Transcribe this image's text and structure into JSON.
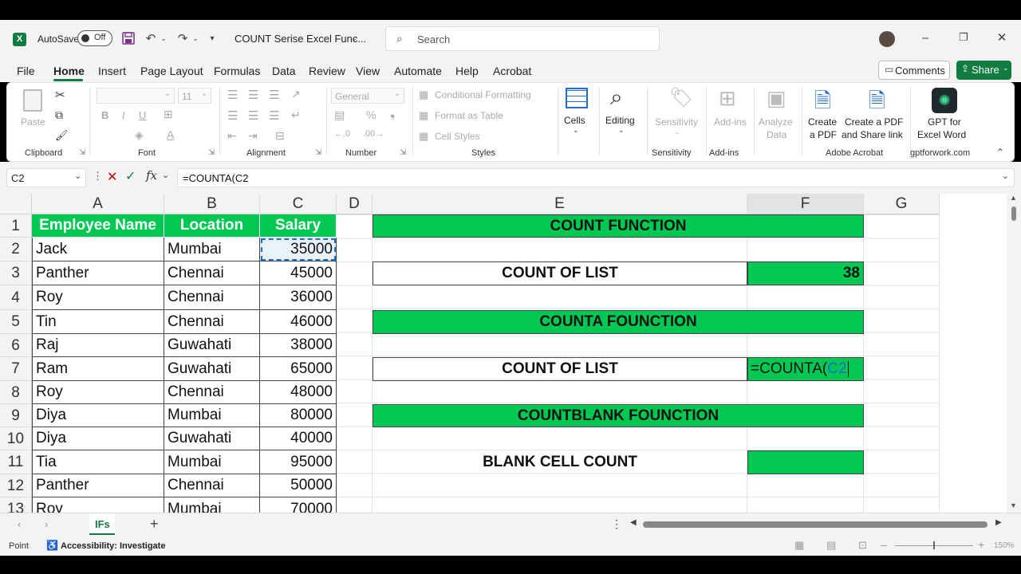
{
  "app": {
    "autosave_label": "AutoSave",
    "autosave_state": "Off",
    "doc_title": "COUNT Serise Excel Func...",
    "search_placeholder": "Search"
  },
  "menu": {
    "tabs": [
      "File",
      "Home",
      "Insert",
      "Page Layout",
      "Formulas",
      "Data",
      "Review",
      "View",
      "Automate",
      "Help",
      "Acrobat"
    ],
    "active": "Home",
    "comments_label": "Comments",
    "share_label": "Share"
  },
  "ribbon": {
    "clipboard": {
      "paste": "Paste",
      "label": "Clipboard"
    },
    "font": {
      "font_name": "",
      "font_size": "11",
      "label": "Font"
    },
    "alignment": {
      "label": "Alignment"
    },
    "number": {
      "format": "General",
      "label": "Number"
    },
    "styles": {
      "conditional": "Conditional Formatting",
      "format_table": "Format as Table",
      "cell_styles": "Cell Styles",
      "label": "Styles"
    },
    "cells": {
      "label": "Cells"
    },
    "editing": {
      "label": "Editing"
    },
    "sensitivity": {
      "button": "Sensitivity",
      "label": "Sensitivity"
    },
    "addins": {
      "button": "Add-ins",
      "label": "Add-ins"
    },
    "analyze": {
      "button1": "Analyze",
      "button2": "Data"
    },
    "acrobat": {
      "create_pdf_1": "Create",
      "create_pdf_2": "a PDF",
      "share_pdf_1": "Create a PDF",
      "share_pdf_2": "and Share link",
      "label": "Adobe Acrobat"
    },
    "gpt": {
      "button1": "GPT for",
      "button2": "Excel Word",
      "label": "gptforwork.com"
    }
  },
  "formula_bar": {
    "name_box": "C2",
    "formula": "=COUNTA(C2"
  },
  "grid": {
    "columns": [
      "A",
      "B",
      "C",
      "D",
      "E",
      "F",
      "G"
    ],
    "rows": [
      "1",
      "2",
      "3",
      "4",
      "5",
      "6",
      "7",
      "8",
      "9",
      "10",
      "11",
      "12",
      "13"
    ],
    "headers": {
      "name": "Employee Name",
      "location": "Location",
      "salary": "Salary"
    },
    "data": [
      {
        "name": "Jack",
        "location": "Mumbai",
        "salary": "35000"
      },
      {
        "name": "Panther",
        "location": "Chennai",
        "salary": "45000"
      },
      {
        "name": "Roy",
        "location": "Chennai",
        "salary": "36000"
      },
      {
        "name": "Tin",
        "location": "Chennai",
        "salary": "46000"
      },
      {
        "name": "Raj",
        "location": "Guwahati",
        "salary": "38000"
      },
      {
        "name": "Ram",
        "location": "Guwahati",
        "salary": "65000"
      },
      {
        "name": "Roy",
        "location": "Chennai",
        "salary": "48000"
      },
      {
        "name": "Diya",
        "location": "Mumbai",
        "salary": "80000"
      },
      {
        "name": "Diya",
        "location": "Guwahati",
        "salary": "40000"
      },
      {
        "name": "Tia",
        "location": "Mumbai",
        "salary": "95000"
      },
      {
        "name": "Panther",
        "location": "Chennai",
        "salary": "50000"
      },
      {
        "name": "Roy",
        "location": "Mumbai",
        "salary": "70000"
      }
    ],
    "panel": {
      "count_function": "COUNT FUNCTION",
      "count_of_list_1": "COUNT OF LIST",
      "count_result": "38",
      "counta_function": "COUNTA FOUNCTION",
      "count_of_list_2": "COUNT OF LIST",
      "counta_formula_prefix": "=COUNTA(",
      "counta_formula_ref": "C2",
      "countblank_function": "COUNTBLANK FOUNCTION",
      "blank_cell_count": "BLANK CELL COUNT"
    }
  },
  "sheets": {
    "tabs": [
      "IFs"
    ],
    "active": "IFs"
  },
  "status": {
    "mode": "Point",
    "accessibility": "Accessibility: Investigate",
    "zoom": "150%"
  },
  "colors": {
    "green": "#00c853",
    "excel_green": "#107c41",
    "accent": "#1e6bd6"
  }
}
